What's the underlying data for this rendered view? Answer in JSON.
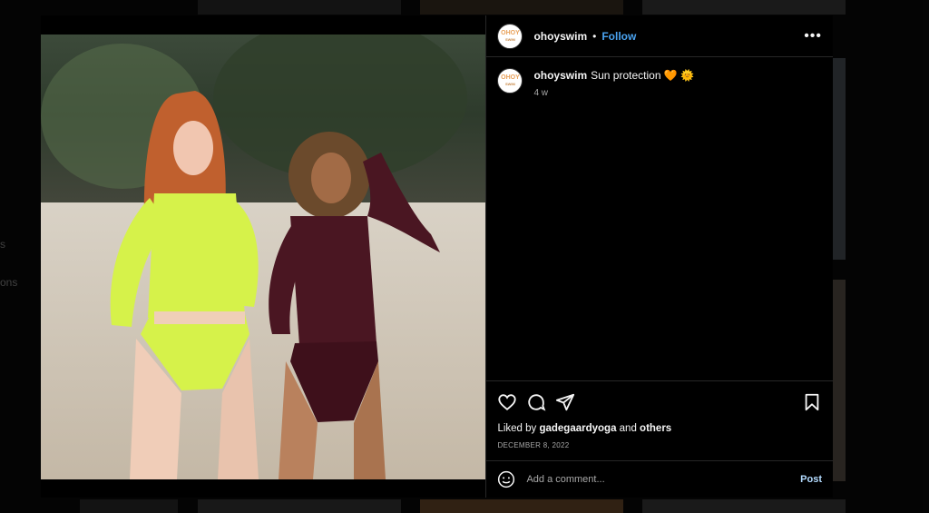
{
  "background": {
    "left_nav_fragments": [
      "s",
      "ons"
    ]
  },
  "post": {
    "username": "ohoyswim",
    "avatar_text": "OHOY",
    "avatar_subtext": "SWIM",
    "follow_label": "Follow",
    "separator": "•",
    "more_label": "•••",
    "caption_username": "ohoyswim",
    "caption_text": "Sun protection 🧡 🌞",
    "time_ago": "4 w",
    "likes_prefix": "Liked by ",
    "likes_user": "gadegaardyoga",
    "likes_middle": " and ",
    "likes_others": "others",
    "date": "DECEMBER 8, 2022",
    "comment_placeholder": "Add a comment...",
    "post_label": "Post"
  },
  "icons": [
    "heart-icon",
    "comment-icon",
    "share-icon",
    "bookmark-icon",
    "emoji-icon",
    "more-icon"
  ],
  "colors": {
    "follow": "#4aa3f0",
    "post_button": "#b3dbff",
    "swimsuit_left": "#d6f24a",
    "swimsuit_right": "#4a1622"
  }
}
